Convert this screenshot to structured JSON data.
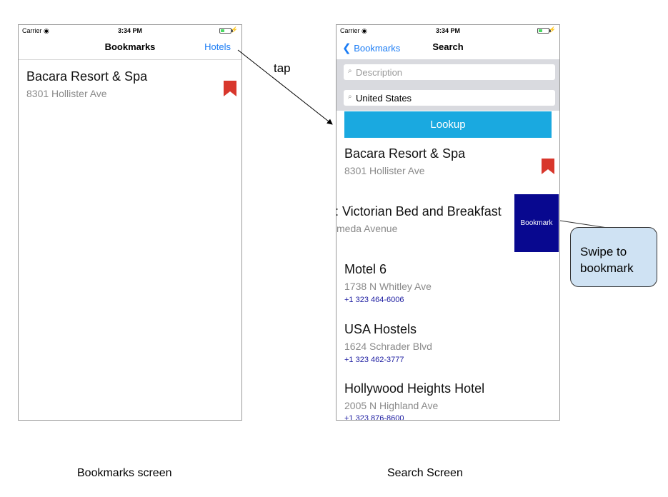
{
  "bookmarks_screen": {
    "status": {
      "carrier": "Carrier",
      "time": "3:34 PM"
    },
    "nav": {
      "title": "Bookmarks",
      "right_button": "Hotels"
    },
    "items": [
      {
        "name": "Bacara Resort & Spa",
        "address": "8301 Hollister Ave",
        "bookmarked": true
      }
    ],
    "caption": "Bookmarks screen"
  },
  "search_screen": {
    "status": {
      "carrier": "Carrier",
      "time": "3:34 PM"
    },
    "nav": {
      "back_label": "Bookmarks",
      "title": "Search"
    },
    "search": {
      "description_placeholder": "Description",
      "location_value": "United States",
      "lookup_label": "Lookup"
    },
    "items": [
      {
        "name": "Bacara Resort & Spa",
        "address": "8301 Hollister Ave",
        "bookmarked": true
      },
      {
        "name": ": Victorian Bed and Breakfast",
        "address": "meda Avenue",
        "swipe_action": "Bookmark"
      },
      {
        "name": "Motel 6",
        "address": "1738 N Whitley Ave",
        "phone": "+1 323 464-6006"
      },
      {
        "name": "USA Hostels",
        "address": "1624 Schrader Blvd",
        "phone": "+1 323 462-3777"
      },
      {
        "name": "Hollywood Heights Hotel",
        "address": "2005 N Highland Ave",
        "phone": "+1 323 876-8600"
      }
    ],
    "caption": "Search Screen"
  },
  "annotations": {
    "arrow_label": "tap",
    "callout": [
      "Swipe to",
      "bookmark"
    ]
  },
  "colors": {
    "accent": "#1a7cf5",
    "bookmark": "#d8372c",
    "lookup": "#1aa9e0",
    "swipe_action": "#08088f",
    "callout_fill": "#cfe2f3"
  }
}
